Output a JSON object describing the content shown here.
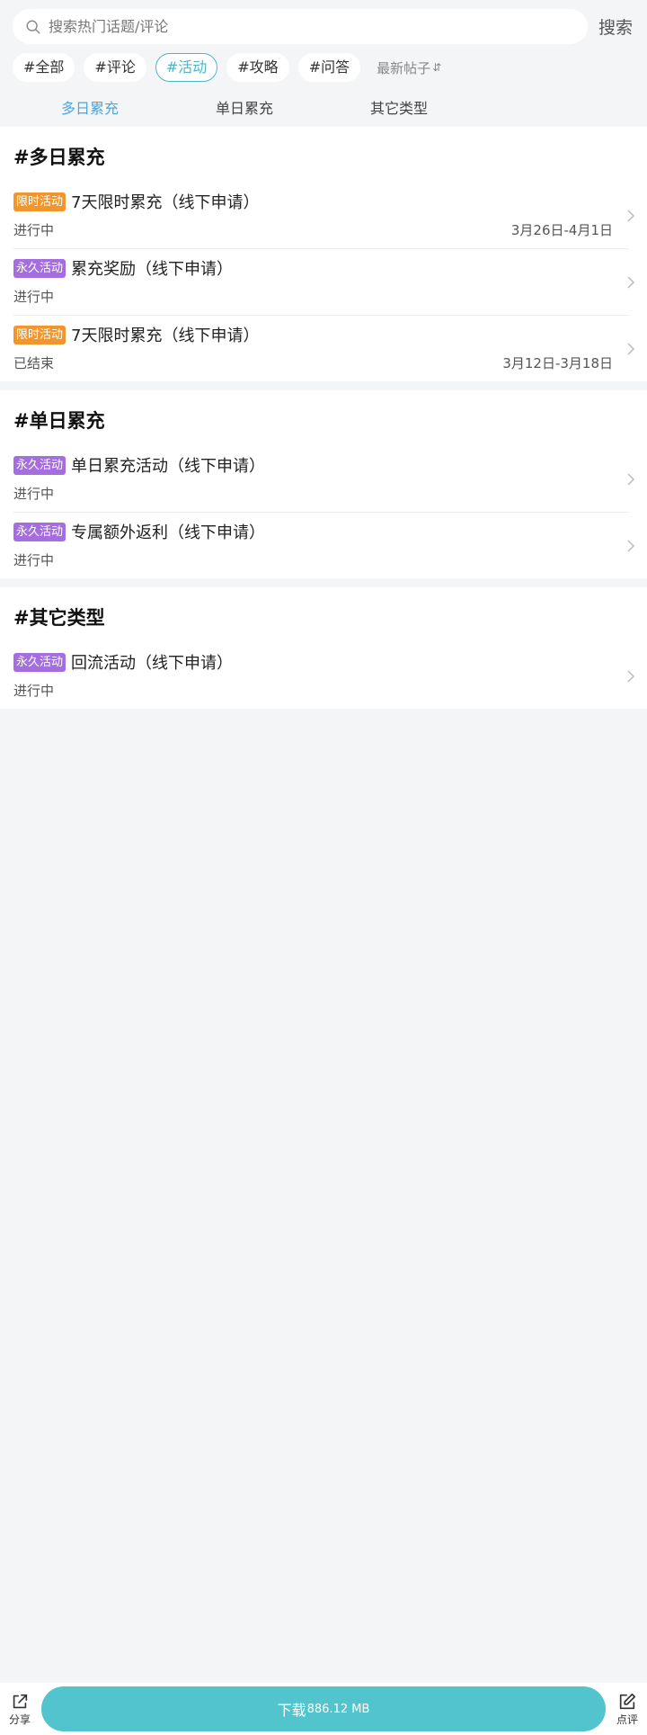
{
  "search": {
    "placeholder": "搜索热门话题/评论",
    "button_label": "搜索"
  },
  "tags": [
    {
      "label": "#全部",
      "active": false
    },
    {
      "label": "#评论",
      "active": false
    },
    {
      "label": "#活动",
      "active": true
    },
    {
      "label": "#攻略",
      "active": false
    },
    {
      "label": "#问答",
      "active": false
    }
  ],
  "sort": {
    "label": "最新帖子",
    "icon": "sort-arrows-icon"
  },
  "category_tabs": [
    {
      "label": "多日累充",
      "active": true
    },
    {
      "label": "单日累充",
      "active": false
    },
    {
      "label": "其它类型",
      "active": false
    }
  ],
  "sections": [
    {
      "title": "#多日累充",
      "items": [
        {
          "badge": "限时活动",
          "badge_type": "limited",
          "title": "7天限时累充（线下申请）",
          "status": "进行中",
          "date": "3月26日-4月1日"
        },
        {
          "badge": "永久活动",
          "badge_type": "permanent",
          "title": "累充奖励（线下申请）",
          "status": "进行中",
          "date": ""
        },
        {
          "badge": "限时活动",
          "badge_type": "limited",
          "title": "7天限时累充（线下申请）",
          "status": "已结束",
          "date": "3月12日-3月18日"
        }
      ]
    },
    {
      "title": "#单日累充",
      "items": [
        {
          "badge": "永久活动",
          "badge_type": "permanent",
          "title": "单日累充活动（线下申请）",
          "status": "进行中",
          "date": ""
        },
        {
          "badge": "永久活动",
          "badge_type": "permanent",
          "title": "专属额外返利（线下申请）",
          "status": "进行中",
          "date": ""
        }
      ]
    },
    {
      "title": "#其它类型",
      "items": [
        {
          "badge": "永久活动",
          "badge_type": "permanent",
          "title": "回流活动（线下申请）",
          "status": "进行中",
          "date": ""
        }
      ]
    }
  ],
  "bottom": {
    "share_label": "分享",
    "download_label": "下载",
    "download_size": "886.12 MB",
    "review_label": "点评"
  },
  "colors": {
    "accent": "#4fb6c7",
    "tab_active": "#4fa6d8",
    "badge_limited": "#f0962d",
    "badge_permanent": "#a56ee0",
    "download_button": "#52c4cd"
  }
}
